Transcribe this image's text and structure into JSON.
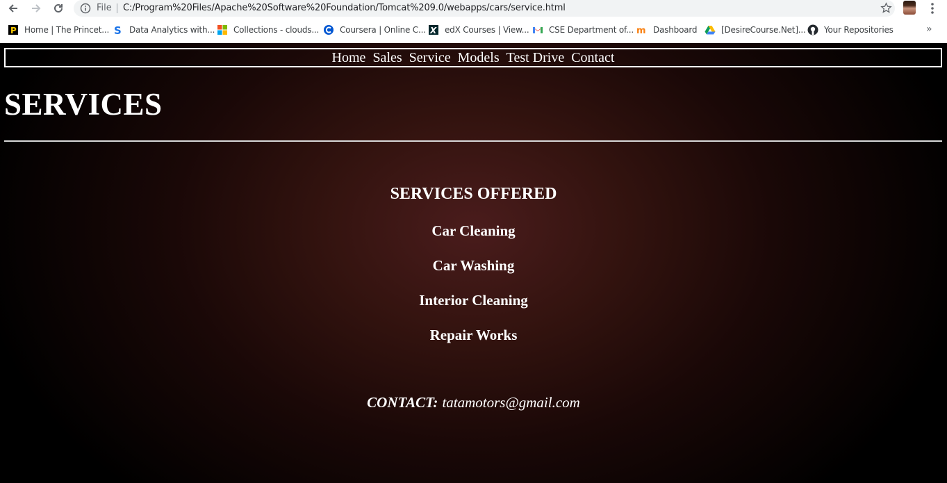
{
  "browser": {
    "file_label": "File",
    "url": "C:/Program%20Files/Apache%20Software%20Foundation/Tomcat%209.0/webapps/cars/service.html",
    "bookmarks": [
      {
        "label": "Home | The Princet...",
        "icon": "princeton-icon"
      },
      {
        "label": "Data Analytics with...",
        "icon": "s-logo-icon"
      },
      {
        "label": "Collections - clouds...",
        "icon": "microsoft-icon"
      },
      {
        "label": "Coursera | Online C...",
        "icon": "coursera-icon"
      },
      {
        "label": "edX Courses | View...",
        "icon": "edx-icon"
      },
      {
        "label": "CSE Department of...",
        "icon": "gmail-icon"
      },
      {
        "label": "Dashboard",
        "icon": "moodle-icon"
      },
      {
        "label": "[DesireCourse.Net]...",
        "icon": "google-drive-icon"
      },
      {
        "label": "Your Repositories",
        "icon": "github-icon"
      }
    ],
    "overflow": "»"
  },
  "site": {
    "nav": [
      "Home",
      "Sales",
      "Service",
      "Models",
      "Test Drive",
      "Contact"
    ],
    "title": "SERVICES",
    "services_heading": "SERVICES OFFERED",
    "services": [
      "Car Cleaning",
      "Car Washing",
      "Interior Cleaning",
      "Repair Works"
    ],
    "contact_label": "CONTACT:",
    "contact_email": "tatamotors@gmail.com"
  },
  "colors": {
    "page_background": "#000000",
    "gradient_center": "#4a1c1c",
    "text": "#ffffff"
  }
}
